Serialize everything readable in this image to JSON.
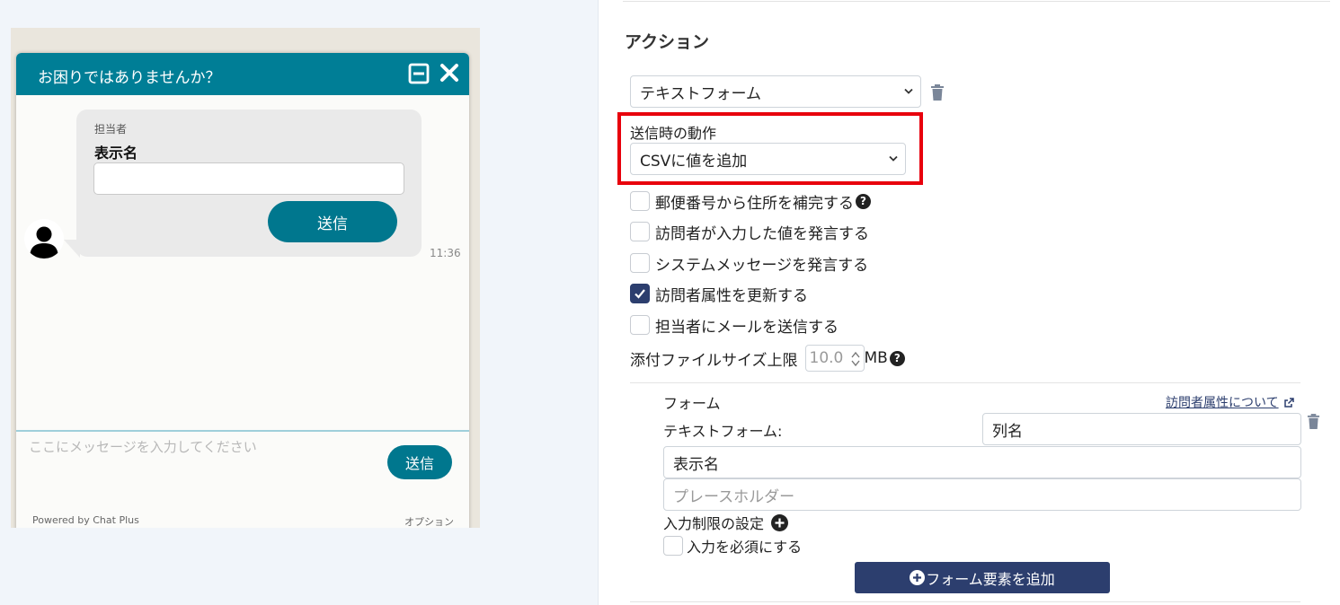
{
  "chat_widget": {
    "title": "お困りではありませんか？",
    "agent_label": "担当者",
    "form_field_label": "表示名",
    "form_send_label": "送信",
    "message_time": "11:36",
    "message_placeholder": "ここにメッセージを入力してください",
    "footer_send_label": "送信",
    "powered_by": "Powered by Chat Plus",
    "option_label": "オプション"
  },
  "action_panel": {
    "section_title": "アクション",
    "action_type": "テキストフォーム",
    "submit_behavior_label": "送信時の動作",
    "submit_behavior_value": "CSVに値を追加",
    "options": [
      {
        "label": "郵便番号から住所を補完する",
        "checked": false
      },
      {
        "label": "訪問者が入力した値を発言する",
        "checked": false
      },
      {
        "label": "システムメッセージを発言する",
        "checked": false
      },
      {
        "label": "訪問者属性を更新する",
        "checked": true
      },
      {
        "label": "担当者にメールを送信する",
        "checked": false
      }
    ],
    "attachment_limit_label": "添付ファイルサイズ上限",
    "attachment_limit_value": "10.0",
    "attachment_limit_unit": "MB",
    "help_glyph": "?"
  },
  "form_section": {
    "form_label": "フォーム",
    "visitor_attr_link": "訪問者属性について",
    "text_form_label": "テキストフォーム:",
    "column_name": "列名",
    "display_name": "表示名",
    "placeholder": "プレースホルダー",
    "input_restriction_label": "入力制限の設定",
    "required_label": "入力を必須にする",
    "add_element_label": "フォーム要素を追加"
  },
  "colors": {
    "widget_teal": "#007e96",
    "navy": "#2c3e6e",
    "highlight_red": "#e8000c"
  }
}
